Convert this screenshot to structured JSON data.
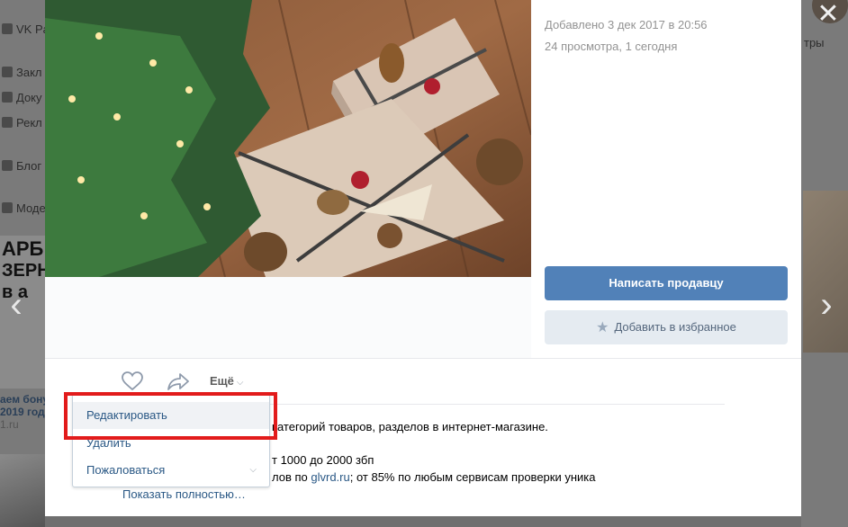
{
  "background": {
    "nav_items": [
      "VK Pa",
      "Закл",
      "Доку",
      "Рекл",
      "Блог",
      "Моде"
    ],
    "ad_lines": [
      "АРБ",
      "ЗЕРНИ",
      "в а"
    ],
    "promo_lines": [
      "аем бону",
      "2019 год",
      "1.ru"
    ],
    "right_text": "тры"
  },
  "meta": {
    "added": "Добавлено 3 дек 2017 в 20:56",
    "views": "24 просмотра, 1 сегодня"
  },
  "buttons": {
    "write_seller": "Написать продавцу",
    "add_favorite": "Добавить в избранное"
  },
  "actions": {
    "more_label": "Ещё"
  },
  "dropdown": {
    "items": [
      {
        "label": "Редактировать"
      },
      {
        "label": "Удалить"
      },
      {
        "label": "Пожаловаться"
      }
    ]
  },
  "description": {
    "line1": "категорий товаров, разделов в интернет-магазине.",
    "line2": "т 1000 до 2000 збп",
    "line3_a": "лов по ",
    "line3_link": "glvrd.ru",
    "line3_b": "; от 85% по любым сервисам проверки уника",
    "show_more": "Показать полностью…"
  },
  "colors": {
    "primary": "#5181b8",
    "secondary": "#e5ebf1",
    "link": "#2a5885",
    "highlight": "#e21b1b"
  }
}
